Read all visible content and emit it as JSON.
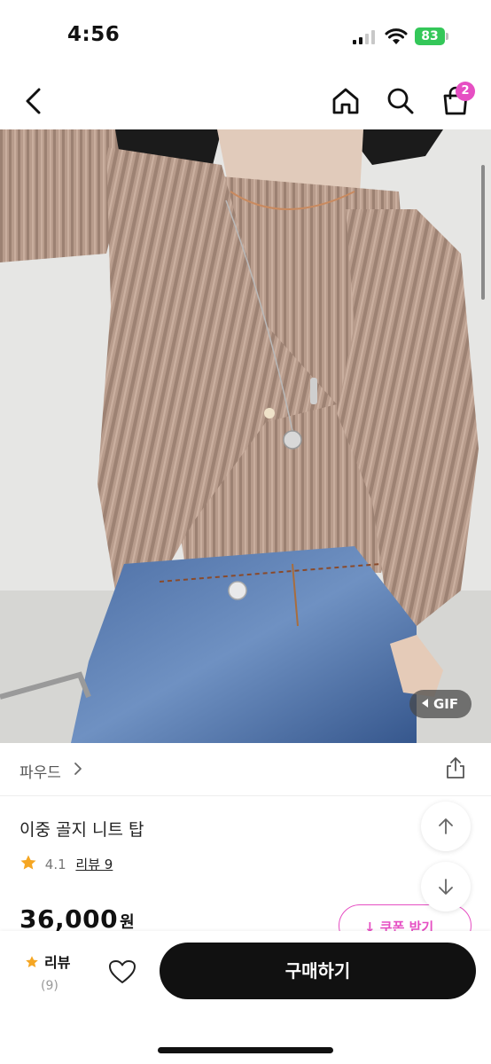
{
  "status_bar": {
    "time": "4:56",
    "battery": "83"
  },
  "nav": {
    "cart_count": "2"
  },
  "image": {
    "gif_label": "GIF"
  },
  "brand": {
    "name": "파우드"
  },
  "product": {
    "title": "이중 골지 니트 탑",
    "rating": "4.1",
    "review_link": "리뷰 9",
    "price": "36,000",
    "currency": "원",
    "coupon_label": "↓ 쿠폰 받기"
  },
  "bottom": {
    "review_label": "리뷰",
    "review_count": "(9)",
    "buy_label": "구매하기"
  },
  "colors": {
    "accent": "#e64fc3",
    "star": "#f5a623",
    "battery": "#34c759"
  }
}
